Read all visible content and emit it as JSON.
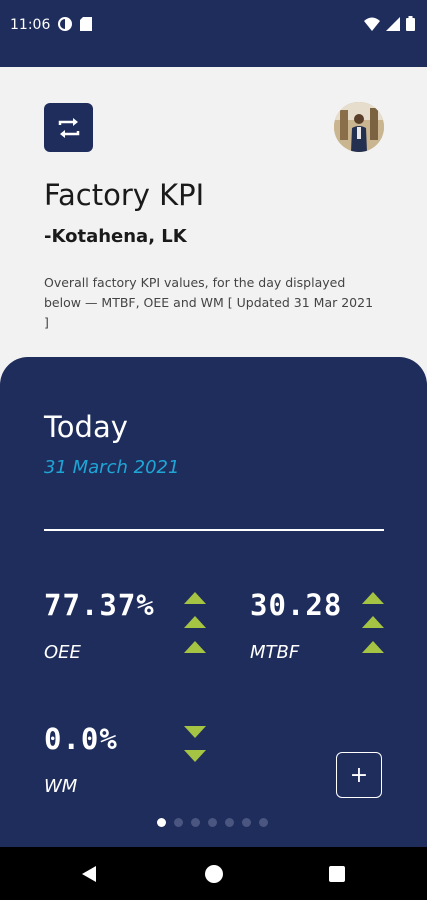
{
  "status_bar": {
    "time": "11:06",
    "left_icons": [
      "data-saver-icon",
      "sd-card-icon"
    ],
    "right_icons": [
      "wifi-icon",
      "signal-icon",
      "battery-icon"
    ]
  },
  "header": {
    "swap_icon": "swap-arrows-icon",
    "title": "Factory KPI",
    "location": "-Kotahena, LK",
    "description": "Overall factory KPI values, for the day displayed below — MTBF, OEE and WM [ Updated 31 Mar 2021 ]"
  },
  "today": {
    "title": "Today",
    "date": "31 March 2021"
  },
  "kpis": [
    {
      "value": "77.37%",
      "label": "OEE",
      "trend": "up"
    },
    {
      "value": "30.28",
      "label": "MTBF",
      "trend": "up"
    },
    {
      "value": "0.0%",
      "label": "WM",
      "trend": "down"
    }
  ],
  "add_button": {
    "label": "+"
  },
  "pager": {
    "count": 7,
    "active": 0
  },
  "colors": {
    "primary": "#1f2d5c",
    "accent_date": "#1ea6d6",
    "trend": "#a5c443",
    "background": "#f2f2f2"
  }
}
